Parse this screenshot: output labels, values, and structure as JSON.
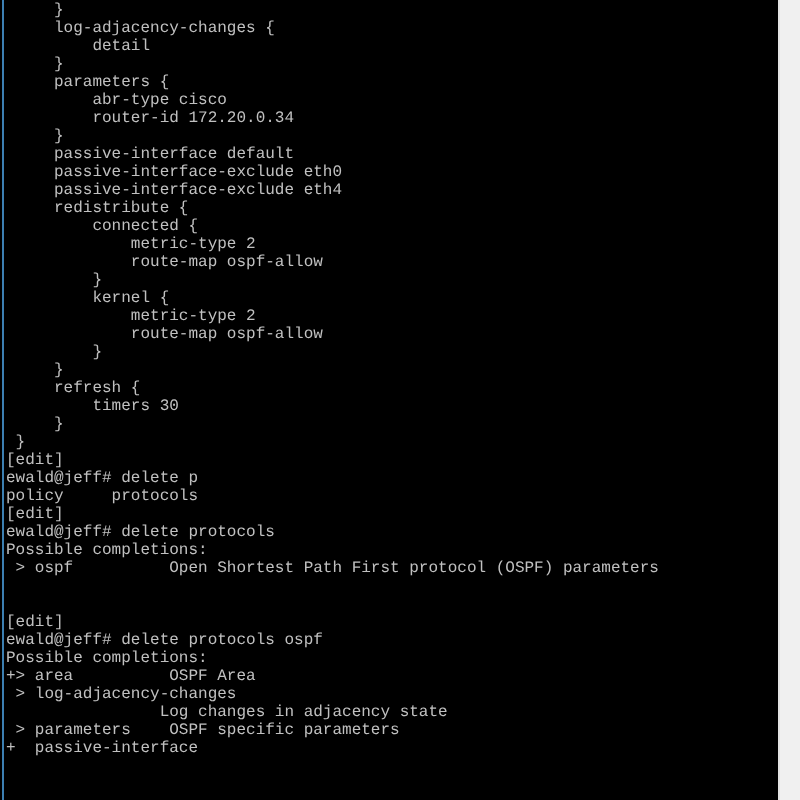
{
  "terminal": {
    "sections": [
      {
        "lines": [
          "     }",
          "     log-adjacency-changes {",
          "         detail",
          "     }",
          "     parameters {",
          "         abr-type cisco",
          "         router-id 172.20.0.34",
          "     }",
          "     passive-interface default",
          "     passive-interface-exclude eth0",
          "     passive-interface-exclude eth4",
          "     redistribute {",
          "         connected {",
          "             metric-type 2",
          "             route-map ospf-allow",
          "         }",
          "         kernel {",
          "             metric-type 2",
          "             route-map ospf-allow",
          "         }",
          "     }",
          "     refresh {",
          "         timers 30",
          "     }",
          " }",
          "[edit]",
          "ewald@jeff# delete p",
          "policy     protocols",
          "[edit]",
          "ewald@jeff# delete protocols",
          "Possible completions:",
          " > ospf          Open Shortest Path First protocol (OSPF) parameters"
        ]
      },
      {
        "lines": [
          "[edit]",
          "ewald@jeff# delete protocols ospf",
          "Possible completions:",
          "+> area          OSPF Area",
          " > log-adjacency-changes",
          "                Log changes in adjacency state",
          " > parameters    OSPF specific parameters",
          "+  passive-interface"
        ]
      }
    ]
  }
}
